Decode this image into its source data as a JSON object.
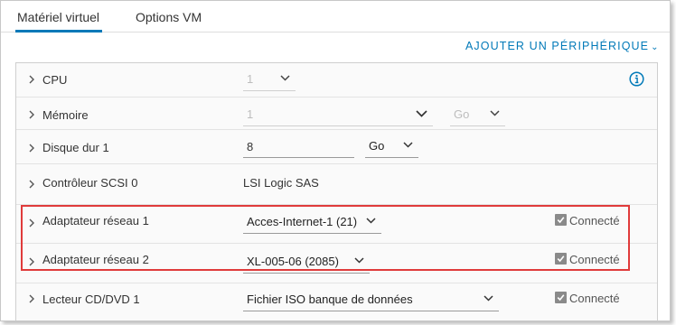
{
  "tabs": [
    {
      "label": "Matériel virtuel",
      "active": true
    },
    {
      "label": "Options VM",
      "active": false
    }
  ],
  "add_device": {
    "label": "AJOUTER UN PÉRIPHÉRIQUE",
    "icon": "chevron-down-icon"
  },
  "rows": {
    "cpu": {
      "label": "CPU",
      "value": "1"
    },
    "memory": {
      "label": "Mémoire",
      "value": "1",
      "unit": "Go"
    },
    "disk": {
      "label": "Disque dur 1",
      "value": "8",
      "unit": "Go"
    },
    "scsi": {
      "label": "Contrôleur SCSI 0",
      "value": "LSI Logic SAS"
    },
    "net1": {
      "label": "Adaptateur réseau 1",
      "value": "Acces-Internet-1 (21)",
      "connected_label": "Connecté"
    },
    "net2": {
      "label": "Adaptateur réseau 2",
      "value": "XL-005-06 (2085)",
      "connected_label": "Connecté"
    },
    "cd": {
      "label": "Lecteur CD/DVD 1",
      "value": "Fichier ISO banque de données",
      "connected_label": "Connecté"
    }
  },
  "colors": {
    "accent": "#0079b8",
    "highlight": "#e03b3b"
  }
}
